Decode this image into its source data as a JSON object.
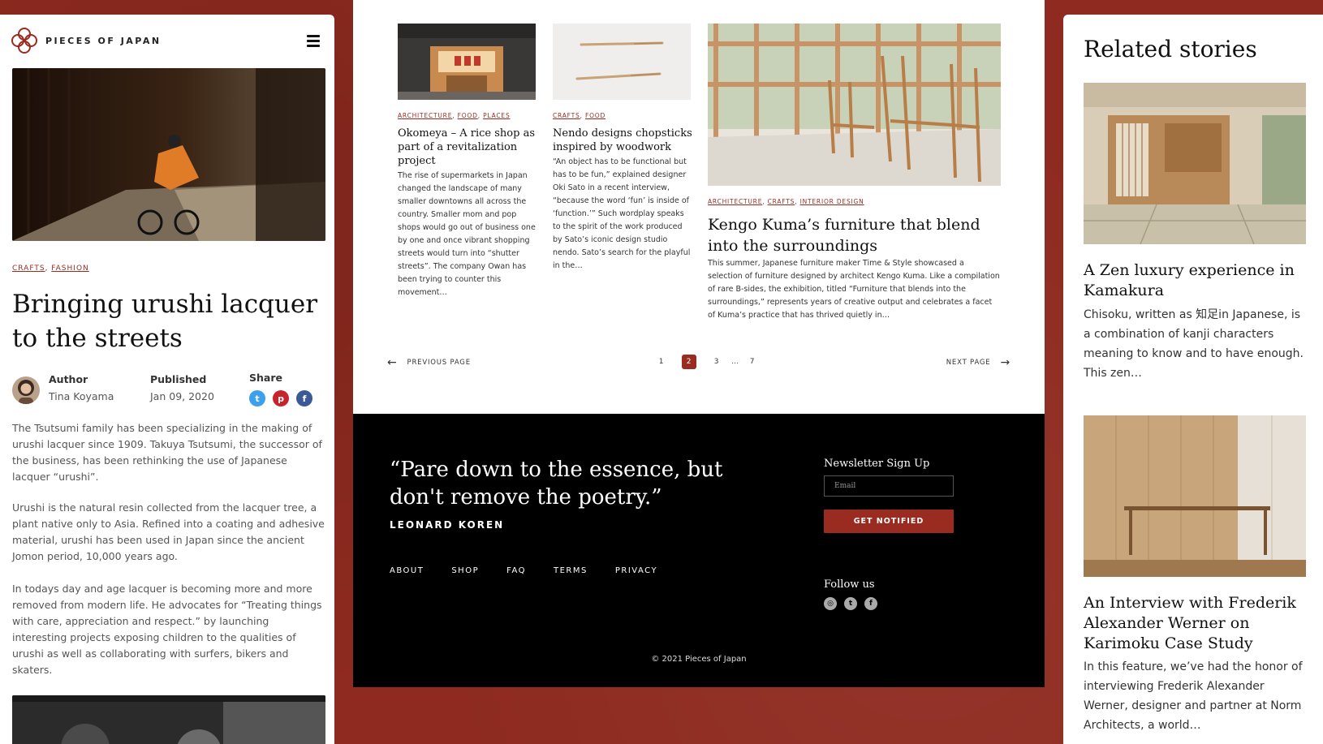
{
  "colors": {
    "accent": "#9a2b20",
    "background": "#8e2a1f",
    "footer": "#000000"
  },
  "left": {
    "brand": "PIECES OF JAPAN",
    "menu_icon": "hamburger-icon",
    "tags": [
      "CRAFTS",
      "FASHION"
    ],
    "title": "Bringing urushi lacquer to the streets",
    "author_label": "Author",
    "author_name": "Tina Koyama",
    "published_label": "Published",
    "published_date": "Jan 09, 2020",
    "share_label": "Share",
    "share_icons": [
      "twitter-icon",
      "pinterest-icon",
      "facebook-icon"
    ],
    "paragraphs": [
      "The Tsutsumi family has been specializing in the making of urushi lacquer since 1909. Takuya Tsutsumi, the successor of the business, has been rethinking the use of Japanese lacquer “urushi”.",
      "Urushi is the natural resin collected from the lacquer tree, a plant native only to Asia. Refined into a coating and adhesive material, urushi has been used in Japan since the ancient Jomon period, 10,000 years ago.",
      "In todays day and age lacquer is becoming more and more removed from modern life. He advocates for “Treating things with care, appreciation and respect.” by launching interesting projects exposing children to the qualities of urushi as well as collaborating with surfers, bikers and skaters."
    ]
  },
  "articles": [
    {
      "tags": [
        "ARCHITECTURE",
        "FOOD",
        "PLACES"
      ],
      "title": "Okomeya – A rice shop as part of a revitalization project",
      "excerpt": "The rise of supermarkets in Japan changed the landscape of many smaller downtowns all across the country. Smaller mom and pop shops would go out of business one by one and once vibrant shopping streets would turn into “shutter streets”. The company Owan has been trying to counter this movement…"
    },
    {
      "tags": [
        "CRAFTS",
        "FOOD"
      ],
      "title": "Nendo designs chopsticks inspired by woodwork",
      "excerpt": "“An object has to be functional but has to be fun,” explained designer Oki Sato in a recent interview, “because the word ‘fun’ is inside of ‘function.’” Such wordplay speaks to the spirit of the work produced by Sato’s iconic design studio nendo. Sato’s search for the playful in the…"
    },
    {
      "tags": [
        "ARCHITECTURE",
        "CRAFTS",
        "INTERIOR DESIGN"
      ],
      "title": "Kengo Kuma’s furniture that blend into the surroundings",
      "excerpt": "This summer, Japanese furniture maker Time & Style showcased a selection of furniture designed by architect Kengo Kuma. Like a compilation of rare B-sides, the exhibition, titled “Furniture that blends into the surroundings,” represents years of creative output and celebrates a facet of Kuma’s practice that has thrived quietly in…"
    }
  ],
  "pagination": {
    "prev_label": "PREVIOUS PAGE",
    "next_label": "NEXT PAGE",
    "pages": [
      "1",
      "2",
      "3",
      "…",
      "7"
    ],
    "current": "2"
  },
  "footer": {
    "quote": "“Pare down to the essence, but don't remove the poetry.”",
    "quote_author": "LEONARD KOREN",
    "nav": [
      "ABOUT",
      "SHOP",
      "FAQ",
      "TERMS",
      "PRIVACY"
    ],
    "newsletter_title": "Newsletter Sign Up",
    "email_placeholder": "Email",
    "button_label": "GET NOTIFIED",
    "follow_label": "Follow us",
    "follow_icons": [
      "instagram-icon",
      "twitter-icon",
      "facebook-icon"
    ],
    "copyright": "© 2021 Pieces of Japan"
  },
  "related": {
    "title": "Related stories",
    "items": [
      {
        "title": "A Zen luxury experience in Kamakura",
        "excerpt": "Chisoku, written as 知足in Japanese, is a combination of kanji characters meaning to know and to have enough. This zen…"
      },
      {
        "title": "An Interview with Frederik Alexander Werner on Karimoku Case Study",
        "excerpt": "In this feature, we’ve had the honor of interviewing Frederik Alexander Werner, designer and partner at Norm Architects, a world…"
      }
    ]
  }
}
